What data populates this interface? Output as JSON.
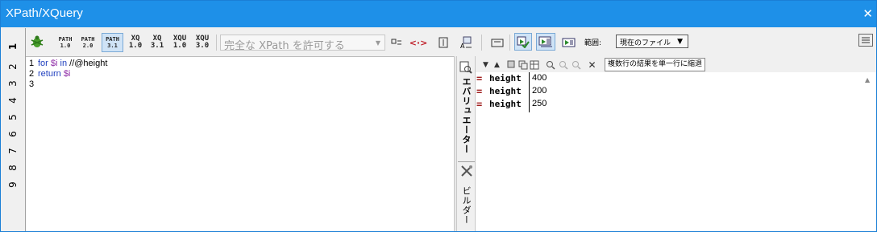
{
  "window": {
    "title": "XPath/XQuery",
    "close": "✕"
  },
  "tabs": [
    "1",
    "2",
    "3",
    "4",
    "5",
    "6",
    "7",
    "8",
    "9"
  ],
  "toolbar": {
    "versions": [
      {
        "top": "PATH",
        "bottom": "1.0"
      },
      {
        "top": "PATH",
        "bottom": "2.0"
      },
      {
        "top": "PATH",
        "bottom": "3.1"
      },
      {
        "top": "XQ",
        "bottom": "1.0"
      },
      {
        "top": "XQ",
        "bottom": "3.1"
      },
      {
        "top": "XQU",
        "bottom": "1.0"
      },
      {
        "top": "XQU",
        "bottom": "3.0"
      }
    ],
    "selected_version": "PATH 3.1",
    "xpath_combo": "完全な XPath を許可する",
    "scope_label": "範囲:",
    "scope_value": "現在のファイル"
  },
  "editor": {
    "lines": [
      {
        "num": "1",
        "kw": "for",
        "var": "$i",
        "kw2": "in",
        "path": "//@height"
      },
      {
        "num": "2",
        "kw": "return",
        "var": "$i"
      },
      {
        "num": "3"
      }
    ]
  },
  "side": {
    "evaluator": "エバリュエーター",
    "builder": "ビルダー"
  },
  "results_toolbar": {
    "mode": "複数行の結果を単一行に縮退"
  },
  "results": [
    {
      "name": "height",
      "value": "400"
    },
    {
      "name": "height",
      "value": "200"
    },
    {
      "name": "height",
      "value": "250"
    }
  ],
  "colors": {
    "titlebar": "#1e90e8",
    "keyword": "#1f3fbf",
    "variable": "#8e2aa6",
    "result_marker": "#a02020"
  }
}
